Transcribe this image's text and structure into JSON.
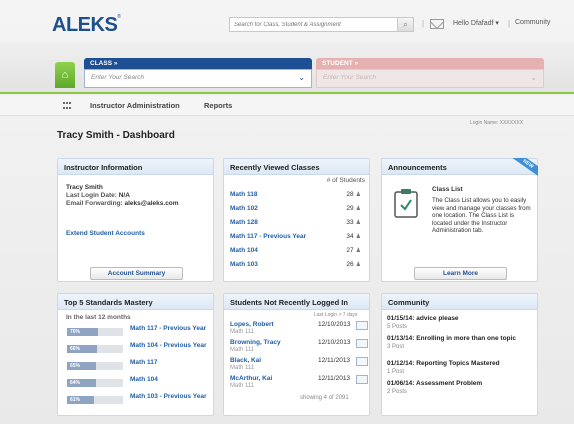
{
  "header": {
    "logo": "ALEKS",
    "logo_mark": "®",
    "search_placeholder": "Search for Class, Student & Assignment",
    "user_greeting": "Hello Dfafadf ▾",
    "separator": "|",
    "community": "Community"
  },
  "class_selector": {
    "label": "CLASS »",
    "placeholder": "Enter Your Search"
  },
  "student_selector": {
    "label": "STUDENT »",
    "placeholder": "Enter Your Search"
  },
  "menu": {
    "admin": "Instructor Administration",
    "reports": "Reports"
  },
  "page": {
    "title": "Tracy Smith - Dashboard",
    "login_name": "Login Name: XXXXXXX"
  },
  "instructor_info": {
    "title": "Instructor Information",
    "name": "Tracy Smith",
    "last_login_label": "Last Login Date:",
    "last_login_value": "N/A",
    "email_label": "Email Forwarding:",
    "email_value": "aleks@aleks.com",
    "extend_link": "Extend Student Accounts",
    "summary_button": "Account Summary"
  },
  "recent_classes": {
    "title": "Recently Viewed Classes",
    "col_header": "# of Students",
    "rows": [
      {
        "name": "Math 118",
        "count": "28"
      },
      {
        "name": "Math 102",
        "count": "29"
      },
      {
        "name": "Math 128",
        "count": "33"
      },
      {
        "name": "Math 117 - Previous Year",
        "count": "34"
      },
      {
        "name": "Math 104",
        "count": "27"
      },
      {
        "name": "Math 103",
        "count": "26"
      }
    ]
  },
  "announcements": {
    "title": "Announcements",
    "badge": "NEW",
    "item_title": "Class List",
    "item_body": "The Class List allows you to easily view and manage your classes from one location. The Class List is located under the Instructor Administration tab.",
    "learn_more": "Learn More"
  },
  "mastery": {
    "title": "Top 5 Standards Mastery",
    "subtitle": "In the last 12 months",
    "rows": [
      {
        "percent": "70%",
        "value": 70,
        "label": "Math 117 - Previous Year"
      },
      {
        "percent": "66%",
        "value": 66,
        "label": "Math 104 - Previous Year"
      },
      {
        "percent": "65%",
        "value": 65,
        "label": "Math 117"
      },
      {
        "percent": "64%",
        "value": 64,
        "label": "Math 104"
      },
      {
        "percent": "61%",
        "value": 61,
        "label": "Math 103 - Previous Year"
      }
    ]
  },
  "not_logged": {
    "title": "Students Not Recently Logged In",
    "col_header": "Last Login > 7 days",
    "rows": [
      {
        "name": "Lopes, Robert",
        "course": "Math 111",
        "date": "12/10/2013"
      },
      {
        "name": "Browning, Tracy",
        "course": "Math 111",
        "date": "12/10/2013"
      },
      {
        "name": "Black, Kai",
        "course": "Math 111",
        "date": "12/11/2013"
      },
      {
        "name": "McArthur, Kai",
        "course": "Math 111",
        "date": "12/11/2013"
      }
    ],
    "footer": "showing 4 of 2091"
  },
  "community_panel": {
    "title": "Community",
    "items": [
      {
        "title": "01/15/14: advice please",
        "posts": "5 Posts"
      },
      {
        "title": "01/13/14: Enrolling in more than one topic",
        "posts": "3 Post"
      },
      {
        "title": "01/12/14: Reporting Topics Mastered",
        "posts": "1 Post"
      },
      {
        "title": "01/06/14: Assessment Problem",
        "posts": "2 Posts"
      }
    ]
  },
  "colors": {
    "brand": "#1f4f93",
    "accent_green": "#8cc63f",
    "student_pink": "#e5b1b1"
  }
}
